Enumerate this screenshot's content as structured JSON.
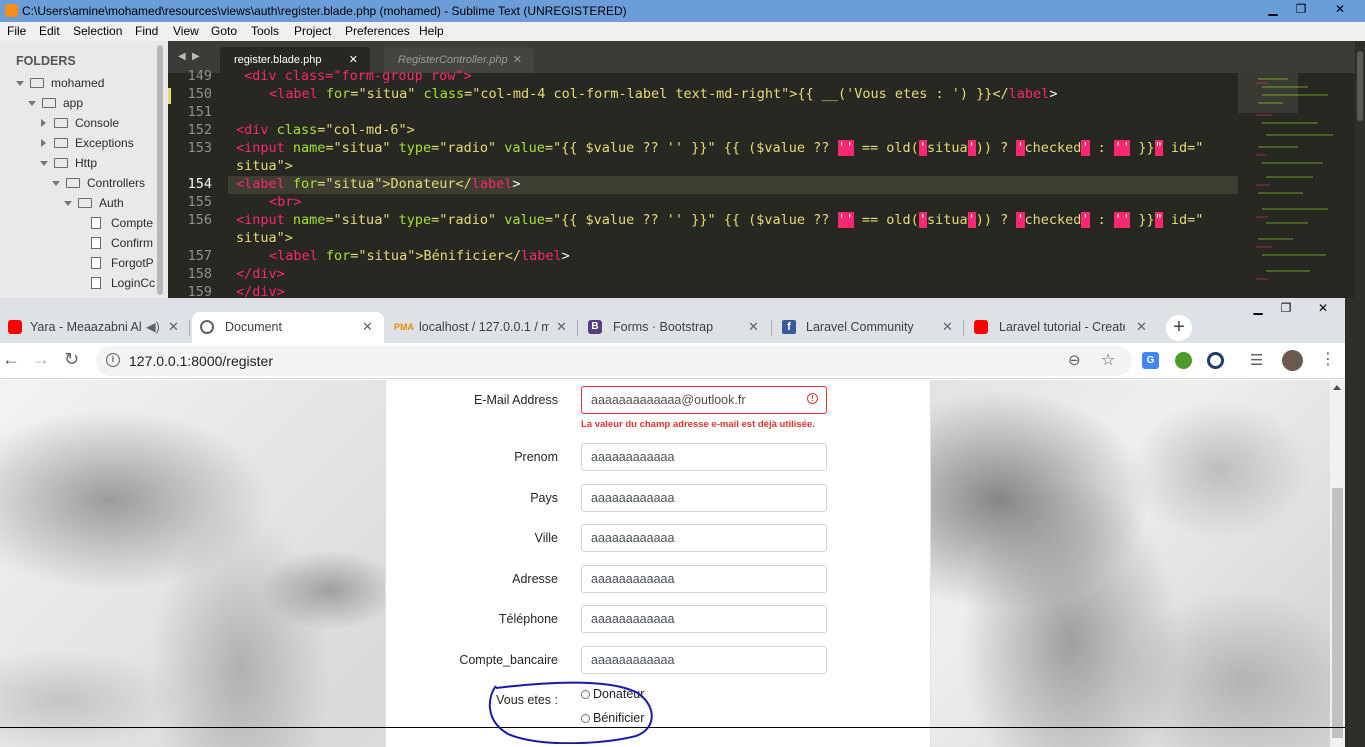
{
  "sublime": {
    "title": "C:\\Users\\amine\\mohamed\\resources\\views\\auth\\register.blade.php (mohamed) - Sublime Text (UNREGISTERED)",
    "menu": [
      "File",
      "Edit",
      "Selection",
      "Find",
      "View",
      "Goto",
      "Tools",
      "Project",
      "Preferences",
      "Help"
    ],
    "sidebar": {
      "heading": "FOLDERS",
      "items": [
        "mohamed",
        "app",
        "Console",
        "Exceptions",
        "Http",
        "Controllers",
        "Auth",
        "Compte",
        "Confirm",
        "ForgotP",
        "LoginCc"
      ]
    },
    "tabs": [
      {
        "label": "register.blade.php",
        "close": "✕"
      },
      {
        "label": "RegisterController.php",
        "close": "✕"
      }
    ],
    "line_numbers": [
      "149",
      "150",
      "151",
      "152",
      "153",
      "",
      "154",
      "155",
      "156",
      "",
      "157",
      "158",
      "159"
    ],
    "code": {
      "l149": "<div class=\"form-group row\">",
      "l150a": "<label",
      "l150b": "for",
      "l150c": "=\"situa\" ",
      "l150d": "class",
      "l150e": "=\"col-md-4 col-form-label text-md-right\">{{ __('Vous etes : ') }}</",
      "l150f": "label",
      "l150g": ">",
      "l152a": "<div ",
      "l152b": "class",
      "l152c": "=\"col-md-6\">",
      "l153a": "<input ",
      "l153b": "name",
      "l153c": "=\"situa\" ",
      "l153d": "type",
      "l153e": "=\"radio\" ",
      "l153f": "value",
      "l153g": "=\"{{ $value ?? '' }}\" {{ ($value ?? ",
      "l153h": "''",
      "l153i": " == old(",
      "l153j": "'",
      "l153k": "situa",
      "l153l": "'",
      "l153m": ")) ? ",
      "l153n": "'",
      "l153o": "checked",
      "l153p": "'",
      "l153q": " : ",
      "l153r": "''",
      "l153s": " }}",
      "l153t": "\"",
      "l153u": " id=\"",
      "l153cont": "situa\">",
      "l154a": "<label ",
      "l154b": "for",
      "l154c": "=\"situa\">Donateur</",
      "l154d": "label",
      "l154e": ">",
      "l155a": "<br>",
      "l156a": "<input ",
      "l156cont": "situa\">",
      "l157a": "<label ",
      "l157b": "for",
      "l157c": "=\"situa\">Bénificier</",
      "l157d": "label",
      "l157e": ">",
      "l158": "</div>",
      "l159": "</div>"
    }
  },
  "chrome": {
    "tabs": [
      {
        "title": "Yara - Meaazabni Al",
        "close": "✕"
      },
      {
        "title": "Document",
        "close": "✕"
      },
      {
        "title": "localhost / 127.0.0.1 / m",
        "close": "✕"
      },
      {
        "title": "Forms · Bootstrap",
        "close": "✕"
      },
      {
        "title": "Laravel Community",
        "close": "✕"
      },
      {
        "title": "Laravel tutorial - Create",
        "close": "✕"
      }
    ],
    "new_tab": "+",
    "url": "127.0.0.1:8000/register"
  },
  "form": {
    "email_label": "E-Mail Address",
    "email_value": "aaaaaaaaaaaaa@outlook.fr",
    "email_error": "La valeur du champ adresse e-mail est déjà utilisée.",
    "fields": [
      {
        "label": "Prenom",
        "value": "aaaaaaaaaaaa"
      },
      {
        "label": "Pays",
        "value": "aaaaaaaaaaaa"
      },
      {
        "label": "Ville",
        "value": "aaaaaaaaaaaa"
      },
      {
        "label": "Adresse",
        "value": "aaaaaaaaaaaa"
      },
      {
        "label": "Téléphone",
        "value": "aaaaaaaaaaaa"
      },
      {
        "label": "Compte_bancaire",
        "value": "aaaaaaaaaaaa"
      }
    ],
    "vous_etes_label": "Vous etes :",
    "radio_options": [
      "Donateur",
      "Bénificier"
    ]
  },
  "colors": {
    "sublime_bg": "#272822",
    "keyword_pink": "#f92672",
    "attr_green": "#a6e22e",
    "string_yellow": "#e6db74",
    "error_red": "#e3342f",
    "annotation_blue": "#1a1aa8"
  }
}
